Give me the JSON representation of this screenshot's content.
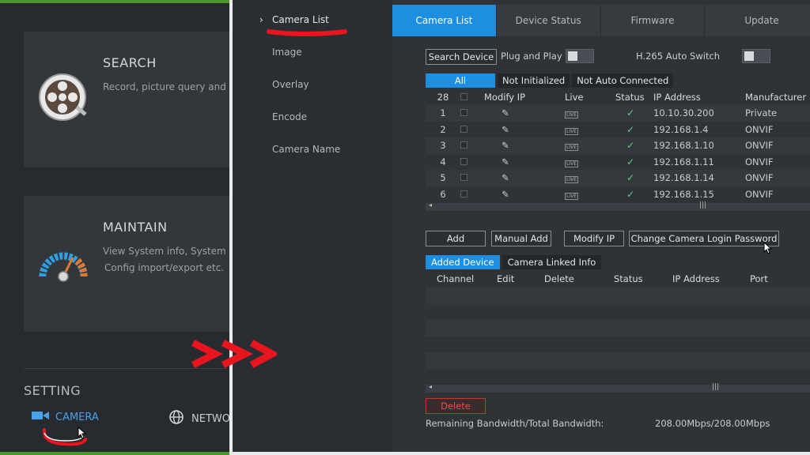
{
  "main_menu": {
    "search": {
      "title": "SEARCH",
      "desc": "Record, picture query and pl"
    },
    "maintain": {
      "title": "MAINTAIN",
      "desc_line1": "View System info, System up",
      "desc_line2": "Config import/export etc."
    },
    "setting": {
      "title": "SETTING",
      "camera_label": "CAMERA",
      "network_label": "NETWO"
    }
  },
  "subnav": {
    "items": [
      {
        "label": "Camera List",
        "active": true
      },
      {
        "label": "Image"
      },
      {
        "label": "Overlay"
      },
      {
        "label": "Encode"
      },
      {
        "label": "Camera Name"
      }
    ]
  },
  "tabs": [
    {
      "label": "Camera List",
      "active": true
    },
    {
      "label": "Device Status"
    },
    {
      "label": "Firmware"
    },
    {
      "label": "Update"
    }
  ],
  "toolbar": {
    "search_device": "Search Device",
    "plug_and_play": "Plug and Play",
    "h265_auto_switch": "H.265 Auto Switch"
  },
  "filter_tabs": [
    "All",
    "Not Initialized",
    "Not Auto Connected"
  ],
  "device_table": {
    "count": "28",
    "headers": [
      "Modify IP",
      "Live",
      "Status",
      "IP Address",
      "Manufacturer"
    ],
    "live_badge": "LIVE",
    "status_check": "✓",
    "rows": [
      {
        "no": "1",
        "ip": "10.10.30.200",
        "manufacturer": "Private"
      },
      {
        "no": "2",
        "ip": "192.168.1.4",
        "manufacturer": "ONVIF"
      },
      {
        "no": "3",
        "ip": "192.168.1.10",
        "manufacturer": "ONVIF"
      },
      {
        "no": "4",
        "ip": "192.168.1.11",
        "manufacturer": "ONVIF"
      },
      {
        "no": "5",
        "ip": "192.168.1.14",
        "manufacturer": "ONVIF"
      },
      {
        "no": "6",
        "ip": "192.168.1.15",
        "manufacturer": "ONVIF"
      }
    ]
  },
  "actions": {
    "add": "Add",
    "manual_add": "Manual Add",
    "modify_ip": "Modify IP",
    "change_password": "Change Camera Login Password"
  },
  "bottom_tabs": [
    "Added Device",
    "Camera Linked Info"
  ],
  "added_table": {
    "headers": [
      "Channel",
      "Edit",
      "Delete",
      "Status",
      "IP Address",
      "Port"
    ]
  },
  "delete_label": "Delete",
  "bandwidth": {
    "label": "Remaining Bandwidth/Total Bandwidth:",
    "value": "208.00Mbps/208.00Mbps"
  },
  "colors": {
    "accent": "#1e8fe0",
    "annotation_red": "#e8141e",
    "status_ok": "#5fd38a"
  }
}
